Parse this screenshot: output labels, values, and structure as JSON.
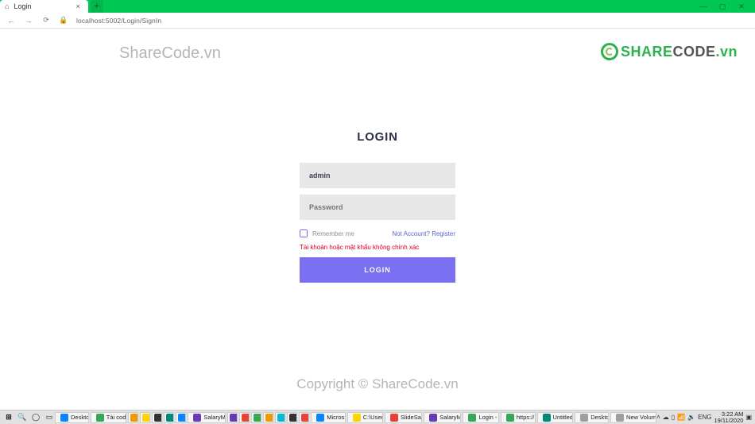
{
  "browser": {
    "tab_title": "Login",
    "url": "localhost:5002/Login/SignIn"
  },
  "watermarks": {
    "top": "ShareCode.vn",
    "bottom": "Copyright © ShareCode.vn",
    "logo_share": "SHARE",
    "logo_code": "CODE",
    "logo_tld": ".vn"
  },
  "login": {
    "title": "LOGIN",
    "username_value": "admin",
    "password_placeholder": "Password",
    "remember_label": "Remember me",
    "register_link": "Not Account? Register",
    "error_message": "Tài khoản hoặc mật khẩu không chính xác",
    "button_label": "LOGIN"
  },
  "taskbar": {
    "items": [
      {
        "label": "Desktop",
        "color": "c-blue"
      },
      {
        "label": "Tải cod...",
        "color": "c-green"
      },
      {
        "label": "",
        "color": "c-orange"
      },
      {
        "label": "",
        "color": "c-yellow"
      },
      {
        "label": "",
        "color": "c-dark"
      },
      {
        "label": "",
        "color": "c-teal"
      },
      {
        "label": "",
        "color": "c-blue"
      },
      {
        "label": "SalaryM...",
        "color": "c-purple"
      },
      {
        "label": "",
        "color": "c-purple"
      },
      {
        "label": "",
        "color": "c-red"
      },
      {
        "label": "",
        "color": "c-green"
      },
      {
        "label": "",
        "color": "c-orange"
      },
      {
        "label": "",
        "color": "c-cyan"
      },
      {
        "label": "",
        "color": "c-dark"
      },
      {
        "label": "",
        "color": "c-red"
      },
      {
        "label": "Micros...",
        "color": "c-blue"
      },
      {
        "label": "C:\\User...",
        "color": "c-yellow"
      },
      {
        "label": "SlideSal...",
        "color": "c-red"
      },
      {
        "label": "SalaryM...",
        "color": "c-purple"
      },
      {
        "label": "Login - ...",
        "color": "c-green"
      },
      {
        "label": "https://...",
        "color": "c-green"
      },
      {
        "label": "Untitled...",
        "color": "c-teal"
      },
      {
        "label": "Desktop",
        "color": "c-grey"
      },
      {
        "label": "New Volume (D:)",
        "color": "c-grey"
      }
    ],
    "lang": "ENG",
    "time": "3:22 AM",
    "date": "19/11/2020"
  }
}
